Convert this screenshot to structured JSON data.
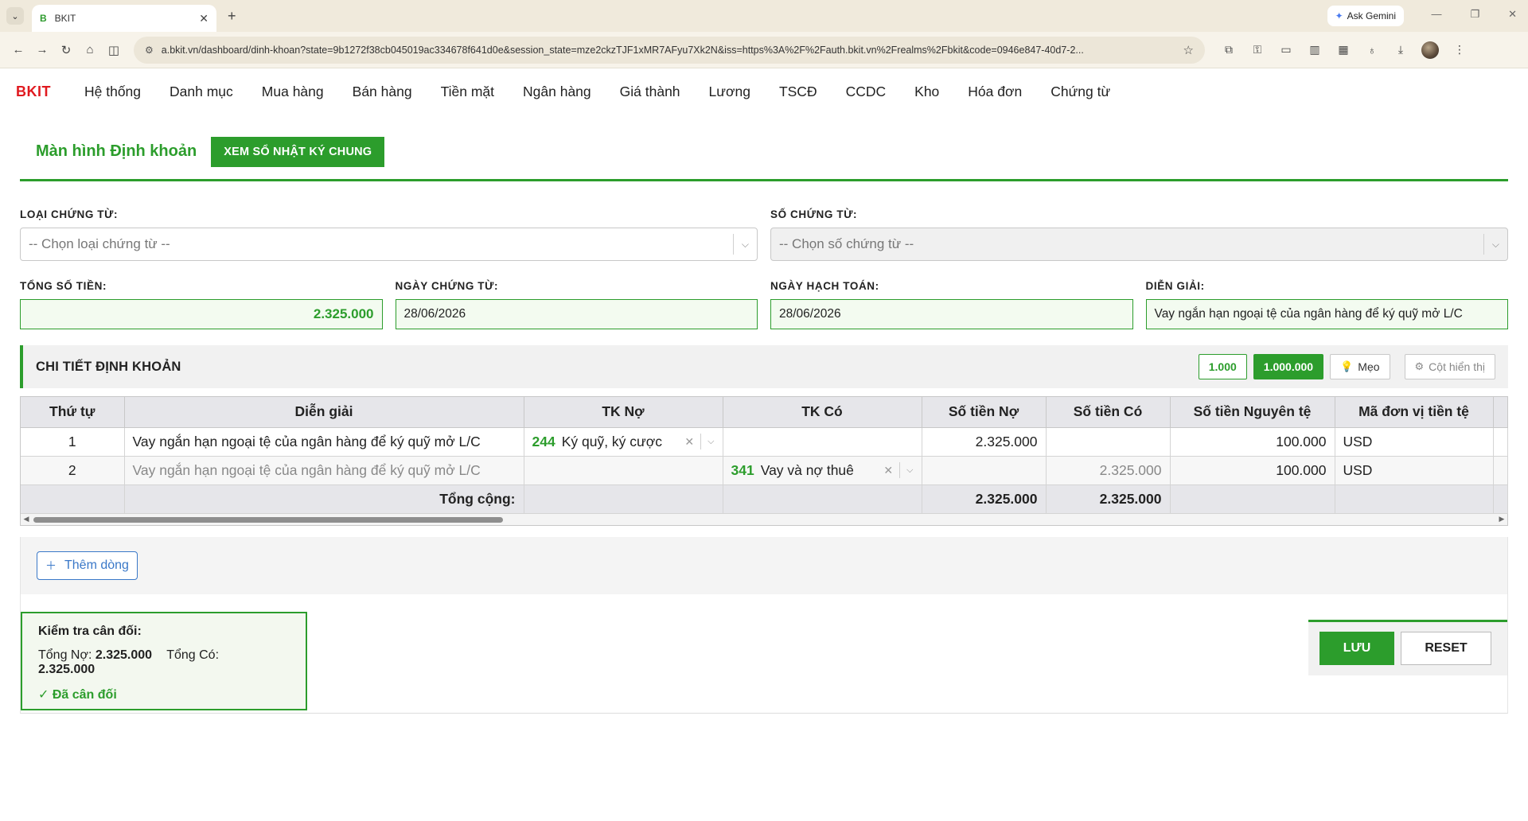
{
  "browser": {
    "tab_title": "BKIT",
    "tab_favicon": "B",
    "gemini_label": "Ask Gemini",
    "url": "a.bkit.vn/dashboard/dinh-khoan?state=9b1272f38cb045019ac334678f641d0e&session_state=mze2ckzTJF1xMR7AFyu7Xk2N&iss=https%3A%2F%2Fauth.bkit.vn%2Frealms%2Fbkit&code=0946e847-40d7-2..."
  },
  "nav": {
    "brand": "BKIT",
    "items": [
      "Hệ thống",
      "Danh mục",
      "Mua hàng",
      "Bán hàng",
      "Tiền mặt",
      "Ngân hàng",
      "Giá thành",
      "Lương",
      "TSCĐ",
      "CCDC",
      "Kho",
      "Hóa đơn",
      "Chứng từ"
    ]
  },
  "page": {
    "title": "Màn hình Định khoản",
    "journal_button": "XEM SỔ NHẬT KÝ CHUNG"
  },
  "form": {
    "voucher_type_label": "LOẠI CHỨNG TỪ:",
    "voucher_type_placeholder": "-- Chọn loại chứng từ --",
    "voucher_no_label": "SỐ CHỨNG TỪ:",
    "voucher_no_placeholder": "-- Chọn số chứng từ --",
    "total_label": "TỔNG SỐ TIỀN:",
    "total_value": "2.325.000",
    "voucher_date_label": "NGÀY CHỨNG TỪ:",
    "voucher_date_value": "28/06/2026",
    "posting_date_label": "NGÀY HẠCH TOÁN:",
    "posting_date_value": "28/06/2026",
    "description_label": "DIỄN GIẢI:",
    "description_value": "Vay ngắn hạn ngoại tệ của ngân hàng để ký quỹ mở L/C"
  },
  "detail": {
    "title": "CHI TIẾT ĐỊNH KHOẢN",
    "unit_1000": "1.000",
    "unit_1000000": "1.000.000",
    "tips": "Mẹo",
    "columns_button": "Cột hiển thị",
    "headers": [
      "Thứ tự",
      "Diễn giải",
      "TK Nợ",
      "TK Có",
      "Số tiền Nợ",
      "Số tiền Có",
      "Số tiền Nguyên tệ",
      "Mã đơn vị tiền tệ"
    ],
    "rows": [
      {
        "order": "1",
        "description": "Vay ngắn hạn ngoại tệ của ngân hàng để ký quỹ mở L/C",
        "debit_code": "244",
        "debit_name": "Ký quỹ, ký cược",
        "credit_code": "",
        "credit_name": "",
        "debit_amount": "2.325.000",
        "credit_amount": "",
        "fx_amount": "100.000",
        "currency": "USD"
      },
      {
        "order": "2",
        "description": "Vay ngắn hạn ngoại tệ của ngân hàng để ký quỹ mở L/C",
        "debit_code": "",
        "debit_name": "",
        "credit_code": "341",
        "credit_name": "Vay và nợ thuê",
        "debit_amount": "",
        "credit_amount": "2.325.000",
        "fx_amount": "100.000",
        "currency": "USD"
      }
    ],
    "total_label": "Tổng cộng:",
    "total_debit": "2.325.000",
    "total_credit": "2.325.000",
    "add_row": "Thêm dòng"
  },
  "balance": {
    "title": "Kiểm tra cân đối:",
    "debit_label": "Tổng Nợ:",
    "debit_value": "2.325.000",
    "credit_label": "Tổng Có:",
    "credit_value": "2.325.000",
    "status": "✓ Đã cân đối"
  },
  "actions": {
    "save": "LƯU",
    "reset": "RESET"
  },
  "colors": {
    "accent": "#2c9d2c",
    "brand": "#e0191f",
    "link": "#3a78c8"
  }
}
